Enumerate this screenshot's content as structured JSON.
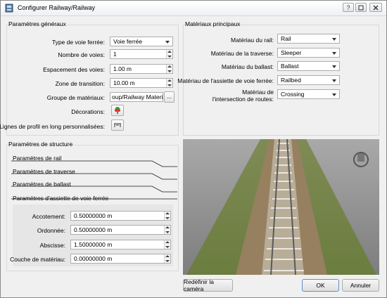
{
  "window": {
    "title": "Configurer Railway/Railway"
  },
  "general": {
    "title": "Paramètres généraux",
    "track_type_label": "Type de voie ferrée:",
    "track_type_value": "Voie ferrée",
    "track_count_label": "Nombre de voies:",
    "track_count_value": "1",
    "track_spacing_label": "Espacement des voies:",
    "track_spacing_value": "1.00 m",
    "transition_label": "Zone de transition:",
    "transition_value": "10.00 m",
    "material_group_label": "Groupe de matériaux:",
    "material_group_value": "oup/Railway Materials",
    "material_group_browse": "...",
    "decorations_label": "Décorations:",
    "profile_lines_label": "Lignes de profil en long personnalisées:"
  },
  "materials": {
    "title": "Matériaux principaux",
    "rail_label": "Matériau du rail:",
    "rail_value": "Rail",
    "sleeper_label": "Matériau de la traverse:",
    "sleeper_value": "Sleeper",
    "ballast_label": "Matériau du ballast:",
    "ballast_value": "Ballast",
    "railbed_label": "Matériau de l'assiette de voie ferrée:",
    "railbed_value": "Railbed",
    "crossing_label_line1": "Matériau de",
    "crossing_label_line2": "l'intersection de routes:",
    "crossing_value": "Crossing"
  },
  "structure": {
    "title": "Paramètres de structure",
    "items": [
      {
        "label": "Paramètres de rail"
      },
      {
        "label": "Paramètres de traverse"
      },
      {
        "label": "Paramètres de ballast"
      },
      {
        "label": "Paramètres d'assiette de voie ferrée"
      }
    ],
    "shoulder_label": "Accotement:",
    "shoulder_value": "0.50000000 m",
    "ordinate_label": "Ordonnée:",
    "ordinate_value": "0.50000000 m",
    "abscissa_label": "Abscisse:",
    "abscissa_value": "1.50000000 m",
    "layer_label": "Couche de matériau:",
    "layer_value": "0.00000000 m"
  },
  "buttons": {
    "reset_camera": "Redéfinir la caméra",
    "ok": "OK",
    "cancel": "Annuler"
  },
  "icons": {
    "app": "app-icon",
    "help": "help-icon",
    "restore": "restore-icon",
    "close": "close-icon",
    "decorations": "tree-icon",
    "profile_lines": "profile-lines-icon",
    "nav": "navigation-cube-icon"
  }
}
